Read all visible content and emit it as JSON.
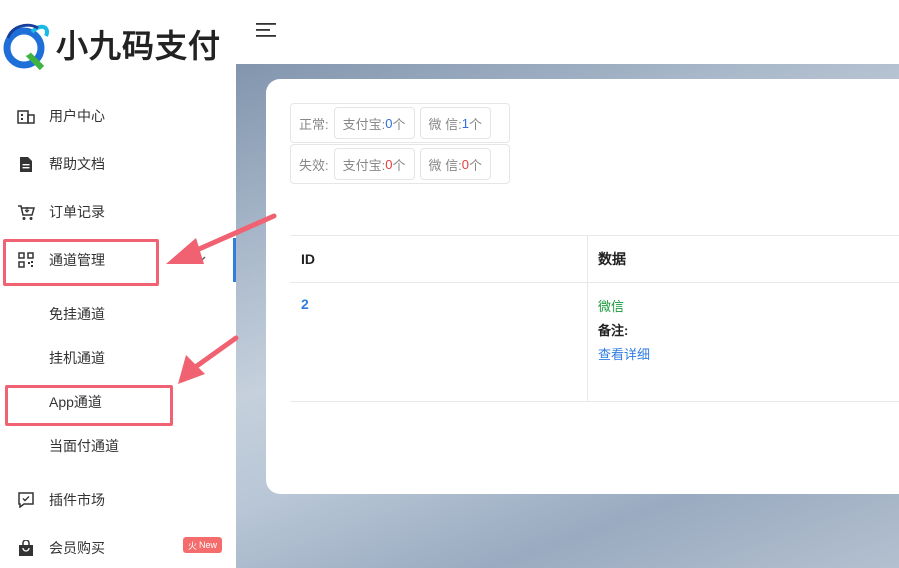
{
  "brand": {
    "name": "小九码支付",
    "logo": "dragon-logo"
  },
  "sidebar": {
    "items": [
      {
        "label": "用户中心",
        "icon": "building-icon"
      },
      {
        "label": "帮助文档",
        "icon": "document-icon"
      },
      {
        "label": "订单记录",
        "icon": "cart-icon"
      },
      {
        "label": "通道管理",
        "icon": "qrcode-icon"
      },
      {
        "label": "插件市场",
        "icon": "chat-check-icon"
      },
      {
        "label": "会员购买",
        "icon": "bag-icon"
      }
    ],
    "sub_items": [
      {
        "label": "免挂通道"
      },
      {
        "label": "挂机通道"
      },
      {
        "label": "App通道"
      },
      {
        "label": "当面付通道"
      }
    ],
    "badge": "New"
  },
  "stats": {
    "normal": {
      "label": "正常:",
      "alipay_label": "支付宝:",
      "alipay_count": "0",
      "wechat_label": "微 信:",
      "wechat_count": "1",
      "unit": "个"
    },
    "invalid": {
      "label": "失效:",
      "alipay_label": "支付宝:",
      "alipay_count": "0",
      "wechat_label": "微 信:",
      "wechat_count": "0",
      "unit": "个"
    }
  },
  "table": {
    "headers": [
      "ID",
      "数据"
    ],
    "rows": [
      {
        "id": "2",
        "type": "微信",
        "note_label": "备注:",
        "link": "查看详细"
      }
    ]
  },
  "colors": {
    "accent": "#2f7de1",
    "highlight": "#f06272",
    "success": "#1a9a3c",
    "danger": "#e43d3d"
  }
}
